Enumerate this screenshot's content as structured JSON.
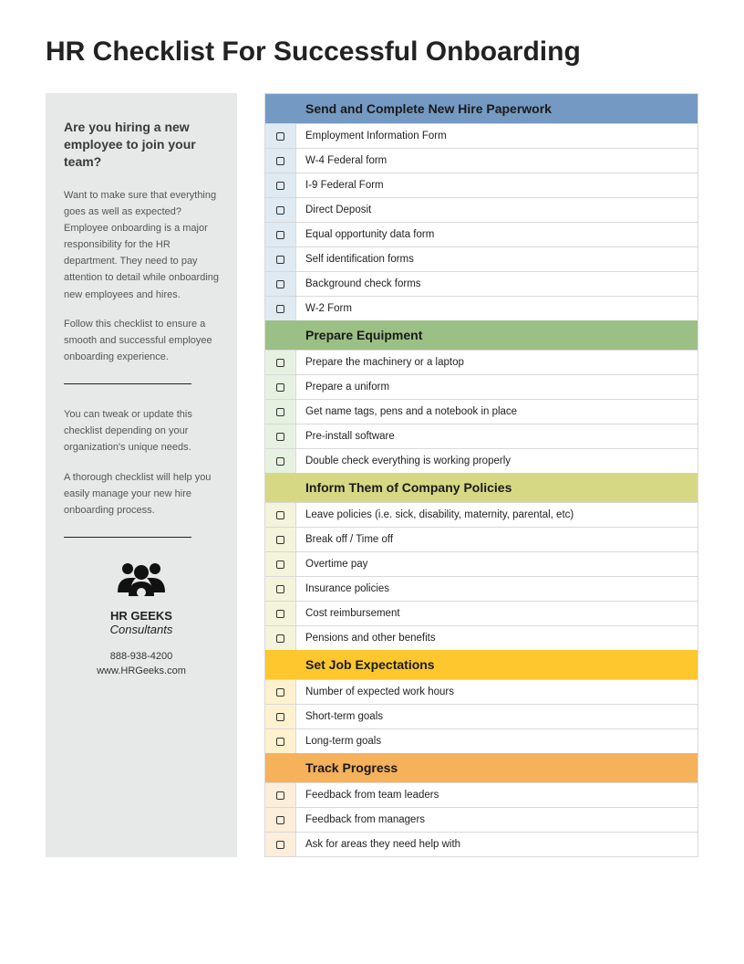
{
  "title": "HR Checklist For Successful Onboarding",
  "sidebar": {
    "heading": "Are you hiring a new employee to join your team?",
    "para1": "Want to make sure that everything goes as well as expected? Employee onboarding is a major responsibility for the HR department. They need to pay attention to detail while onboarding new employees and hires.",
    "para2": "Follow this checklist to ensure a smooth and successful employee onboarding experience.",
    "para3": "You can tweak or update this checklist depending on your organization's unique needs.",
    "para4": "A thorough checklist will help you easily manage your new hire onboarding process.",
    "company_name": "HR GEEKS",
    "company_sub": "Consultants",
    "phone": "888-938-4200",
    "website": "www.HRGeeks.com"
  },
  "sections": [
    {
      "title": "Send and Complete New Hire Paperwork",
      "items": [
        "Employment Information Form",
        "W-4 Federal form",
        "I-9 Federal Form",
        "Direct Deposit",
        "Equal opportunity data form",
        "Self identification forms",
        "Background check forms",
        "W-2 Form"
      ]
    },
    {
      "title": "Prepare Equipment",
      "items": [
        "Prepare the machinery or a laptop",
        "Prepare a uniform",
        "Get name tags, pens and a notebook in place",
        "Pre-install software",
        "Double check everything is working properly"
      ]
    },
    {
      "title": "Inform Them of Company Policies",
      "items": [
        "Leave policies (i.e. sick, disability, maternity, parental, etc)",
        "Break off / Time off",
        "Overtime pay",
        "Insurance policies",
        "Cost reimbursement",
        "Pensions and other benefits"
      ]
    },
    {
      "title": "Set Job Expectations",
      "items": [
        "Number of expected work hours",
        "Short-term goals",
        "Long-term goals"
      ]
    },
    {
      "title": "Track Progress",
      "items": [
        "Feedback from team leaders",
        "Feedback from managers",
        "Ask for areas they need help with"
      ]
    }
  ]
}
